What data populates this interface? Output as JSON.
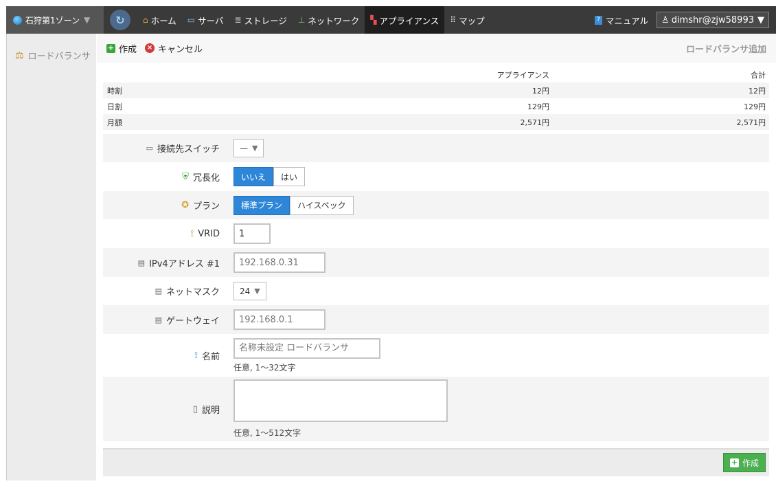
{
  "nav": {
    "zone": "石狩第1ゾーン",
    "items": [
      {
        "icon": "home-icon",
        "label": "ホーム"
      },
      {
        "icon": "server-icon",
        "label": "サーバ"
      },
      {
        "icon": "storage-icon",
        "label": "ストレージ"
      },
      {
        "icon": "network-icon",
        "label": "ネットワーク"
      },
      {
        "icon": "appliance-icon",
        "label": "アプライアンス"
      },
      {
        "icon": "map-icon",
        "label": "マップ"
      }
    ],
    "manual": "マニュアル",
    "user": "dimshr@zjw58993"
  },
  "sidebar": {
    "item": "ロードバランサ"
  },
  "actions": {
    "create": "作成",
    "cancel": "キャンセル",
    "title": "ロードバランサ追加"
  },
  "cost": {
    "headers": [
      "",
      "アプライアンス",
      "合計"
    ],
    "rows": [
      {
        "label": "時割",
        "appliance": "12円",
        "total": "12円"
      },
      {
        "label": "日割",
        "appliance": "129円",
        "total": "129円"
      },
      {
        "label": "月額",
        "appliance": "2,571円",
        "total": "2,571円"
      }
    ]
  },
  "form": {
    "switch": {
      "label": "接続先スイッチ",
      "value": "—"
    },
    "redundant": {
      "label": "冗長化",
      "options": [
        "いいえ",
        "はい"
      ]
    },
    "plan": {
      "label": "プラン",
      "options": [
        "標準プラン",
        "ハイスペック"
      ]
    },
    "vrid": {
      "label": "VRID",
      "value": "1"
    },
    "ipv4": {
      "label": "IPv4アドレス #1",
      "placeholder": "192.168.0.31"
    },
    "netmask": {
      "label": "ネットマスク",
      "value": "24"
    },
    "gateway": {
      "label": "ゲートウェイ",
      "placeholder": "192.168.0.1"
    },
    "name": {
      "label": "名前",
      "placeholder": "名称未設定 ロードバランサ",
      "hint": "任意, 1〜32文字"
    },
    "desc": {
      "label": "説明",
      "hint": "任意, 1〜512文字"
    }
  },
  "footer": {
    "submit": "作成"
  }
}
